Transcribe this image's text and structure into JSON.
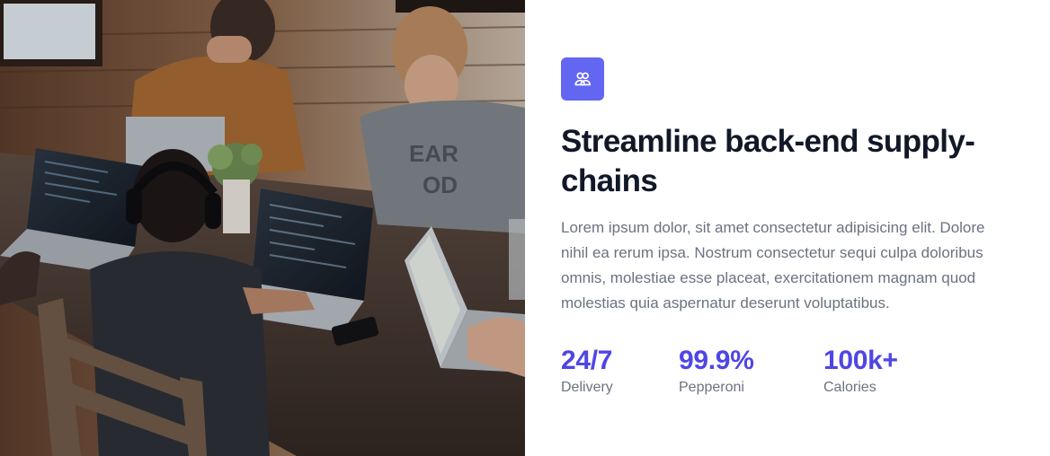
{
  "hero_image": {
    "description_icon": "team-working-photo"
  },
  "feature": {
    "icon": "users-icon",
    "accent_color": "#6366f1",
    "title": "Streamline back-end supply-chains",
    "body": "Lorem ipsum dolor, sit amet consectetur adipisicing elit. Dolore nihil ea rerum ipsa. Nostrum consectetur sequi culpa doloribus omnis, molestiae esse placeat, exercitationem magnam quod molestias quia aspernatur deserunt voluptatibus."
  },
  "stats": [
    {
      "value": "24/7",
      "label": "Delivery"
    },
    {
      "value": "99.9%",
      "label": "Pepperoni"
    },
    {
      "value": "100k+",
      "label": "Calories"
    }
  ],
  "colors": {
    "stat_value": "#4f46e5",
    "heading": "#111827",
    "muted": "#6b7280"
  }
}
